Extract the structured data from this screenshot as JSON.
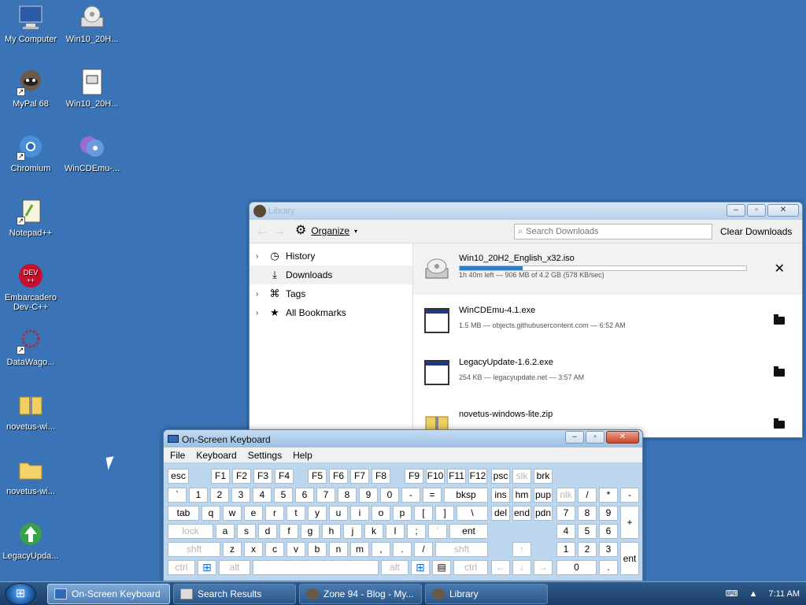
{
  "desktop": {
    "icons": [
      {
        "label": "My Computer",
        "icon": "computer-icon"
      },
      {
        "label": "Win10_20H...",
        "icon": "cd-drive-icon"
      },
      {
        "label": "MyPal 68",
        "icon": "mypal-browser-icon"
      },
      {
        "label": "Win10_20H...",
        "icon": "document-icon"
      },
      {
        "label": "Chromium",
        "icon": "chromium-icon"
      },
      {
        "label": "WinCDEmu-...",
        "icon": "wincdemu-icon"
      },
      {
        "label": "Notepad++",
        "icon": "notepad-plus-plus-icon"
      },
      {
        "label": "Embarcadero Dev-C++",
        "icon": "devcpp-icon"
      },
      {
        "label": "DataWago...",
        "icon": "datawagon-icon"
      },
      {
        "label": "novetus-wi...",
        "icon": "zip-folder-icon"
      },
      {
        "label": "novetus-wi...",
        "icon": "folder-icon"
      },
      {
        "label": "LegacyUpda...",
        "icon": "legacy-update-icon"
      }
    ]
  },
  "library": {
    "title": "Library",
    "organize_label": "Organize",
    "search_placeholder": "Search Downloads",
    "clear_label": "Clear Downloads",
    "sidebar": [
      {
        "label": "History",
        "icon": "clock-icon",
        "expandable": true
      },
      {
        "label": "Downloads",
        "icon": "download-icon",
        "expandable": false
      },
      {
        "label": "Tags",
        "icon": "tag-icon",
        "expandable": true
      },
      {
        "label": "All Bookmarks",
        "icon": "star-icon",
        "expandable": true
      }
    ],
    "downloads": [
      {
        "name": "Win10_20H2_English_x32.iso",
        "meta": "1h 40m left — 906 MB of 4.2 GB (578 KB/sec)",
        "progress": 0.22,
        "icon": "cd-drive-icon",
        "action": "cancel-icon"
      },
      {
        "name": "WinCDEmu-4.1.exe",
        "meta": "1.5 MB — objects.githubusercontent.com — 6:52 AM",
        "icon": "exe-icon",
        "action": "folder-icon"
      },
      {
        "name": "LegacyUpdate-1.6.2.exe",
        "meta": "254 KB — legacyupdate.net — 3:57 AM",
        "icon": "exe-icon",
        "action": "folder-icon"
      },
      {
        "name": "novetus-windows-lite.zip",
        "meta": "",
        "icon": "zip-folder-icon",
        "action": "folder-icon"
      }
    ]
  },
  "osk": {
    "title": "On-Screen Keyboard",
    "menu": [
      "File",
      "Keyboard",
      "Settings",
      "Help"
    ],
    "keys": {
      "esc": "esc",
      "f1": "F1",
      "f2": "F2",
      "f3": "F3",
      "f4": "F4",
      "f5": "F5",
      "f6": "F6",
      "f7": "F7",
      "f8": "F8",
      "f9": "F9",
      "f10": "F10",
      "f11": "F11",
      "f12": "F12",
      "psc": "psc",
      "slk": "slk",
      "brk": "brk",
      "grave": "`",
      "n1": "1",
      "n2": "2",
      "n3": "3",
      "n4": "4",
      "n5": "5",
      "n6": "6",
      "n7": "7",
      "n8": "8",
      "n9": "9",
      "n0": "0",
      "minus": "-",
      "equal": "=",
      "bksp": "bksp",
      "ins": "ins",
      "hm": "hm",
      "pup": "pup",
      "nlk": "nlk",
      "kpdiv": "/",
      "kpmul": "*",
      "kpsub": "-",
      "tab": "tab",
      "q": "q",
      "w": "w",
      "e": "e",
      "r": "r",
      "t": "t",
      "y": "y",
      "u": "u",
      "i": "i",
      "o": "o",
      "p": "p",
      "lbr": "[",
      "rbr": "]",
      "bslash": "\\",
      "del": "del",
      "end": "end",
      "pdn": "pdn",
      "kp7": "7",
      "kp8": "8",
      "kp9": "9",
      "kpadd": "+",
      "lock": "lock",
      "a": "a",
      "s": "s",
      "d": "d",
      "f": "f",
      "g": "g",
      "h": "h",
      "j": "j",
      "k": "k",
      "l": "l",
      "semi": ";",
      "quote": "'",
      "ent": "ent",
      "kp4": "4",
      "kp5": "5",
      "kp6": "6",
      "lshft": "shft",
      "z": "z",
      "x": "x",
      "c": "c",
      "v": "v",
      "b": "b",
      "n": "n",
      "m": "m",
      "comma": ",",
      "period": ".",
      "slash": "/",
      "rshft": "shft",
      "up": "↑",
      "kp1": "1",
      "kp2": "2",
      "kp3": "3",
      "kpent": "ent",
      "lctrl": "ctrl",
      "win": "⊞",
      "lalt": "alt",
      "space": "",
      "ralt": "alt",
      "rwin": "⊞",
      "menu": "▤",
      "rctrl": "ctrl",
      "left": "←",
      "down": "↓",
      "right": "→",
      "kp0": "0",
      "kpdot": "."
    }
  },
  "taskbar": {
    "buttons": [
      {
        "label": "On-Screen Keyboard",
        "active": true
      },
      {
        "label": "Search Results",
        "active": false
      },
      {
        "label": "Zone 94 - Blog - My...",
        "active": false
      },
      {
        "label": "Library",
        "active": false
      }
    ],
    "tray_time": "7:11 AM"
  }
}
